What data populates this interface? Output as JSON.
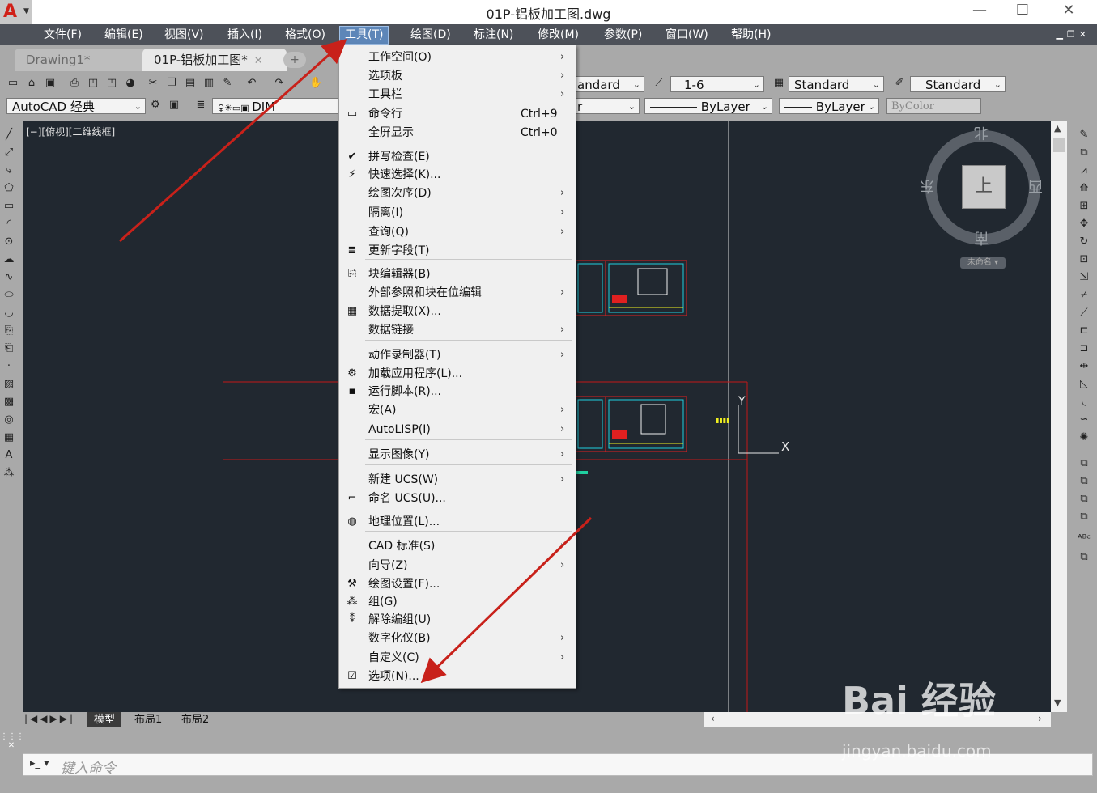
{
  "window": {
    "title": "01P-铝板加工图.dwg",
    "minimize": "—",
    "maximize": "☐",
    "close": "✕"
  },
  "menubar": {
    "items": [
      {
        "label": "文件(F)"
      },
      {
        "label": "编辑(E)"
      },
      {
        "label": "视图(V)"
      },
      {
        "label": "插入(I)"
      },
      {
        "label": "格式(O)"
      },
      {
        "label": "工具(T)"
      },
      {
        "label": "绘图(D)"
      },
      {
        "label": "标注(N)"
      },
      {
        "label": "修改(M)"
      },
      {
        "label": "参数(P)"
      },
      {
        "label": "窗口(W)"
      },
      {
        "label": "帮助(H)"
      }
    ],
    "active": "工具(T)"
  },
  "tabs": [
    {
      "label": "Drawing1*"
    },
    {
      "label": "01P-铝板加工图*"
    }
  ],
  "toolbars": {
    "workspace": "AutoCAD 经典",
    "layer": "DIM",
    "dim_style": "andard",
    "scale": "1-6",
    "table_style": "Standard",
    "multileader_style": "Standard",
    "color_partial": "r",
    "linetype": "ByLayer",
    "lineweight": "ByLayer",
    "plotstyle": "ByColor"
  },
  "viewport_label": "[−][俯视][二维线框]",
  "viewcube": {
    "north": "北",
    "south": "南",
    "east": "东",
    "west": "西",
    "top": "上",
    "ucs": "未命名"
  },
  "ucs_icon": {
    "y": "Y",
    "x": "X"
  },
  "dropdown": {
    "items": [
      {
        "label": "工作空间(O)",
        "shortcut": "",
        "submenu": true,
        "icon": ""
      },
      {
        "label": "选项板",
        "shortcut": "",
        "submenu": true,
        "icon": ""
      },
      {
        "label": "工具栏",
        "shortcut": "",
        "submenu": true,
        "icon": ""
      },
      {
        "label": "命令行",
        "shortcut": "Ctrl+9",
        "submenu": false,
        "icon": "command-line-icon"
      },
      {
        "label": "全屏显示",
        "shortcut": "Ctrl+0",
        "submenu": false,
        "icon": ""
      },
      {
        "label": "拼写检查(E)",
        "shortcut": "",
        "submenu": false,
        "icon": "spellcheck-icon"
      },
      {
        "label": "快速选择(K)...",
        "shortcut": "",
        "submenu": false,
        "icon": "quick-select-icon"
      },
      {
        "label": "绘图次序(D)",
        "shortcut": "",
        "submenu": true,
        "icon": ""
      },
      {
        "label": "隔离(I)",
        "shortcut": "",
        "submenu": true,
        "icon": ""
      },
      {
        "label": "查询(Q)",
        "shortcut": "",
        "submenu": true,
        "icon": ""
      },
      {
        "label": "更新字段(T)",
        "shortcut": "",
        "submenu": false,
        "icon": "update-field-icon"
      },
      {
        "label": "块编辑器(B)",
        "shortcut": "",
        "submenu": false,
        "icon": "block-editor-icon"
      },
      {
        "label": "外部参照和块在位编辑",
        "shortcut": "",
        "submenu": true,
        "icon": ""
      },
      {
        "label": "数据提取(X)...",
        "shortcut": "",
        "submenu": false,
        "icon": "data-extraction-icon"
      },
      {
        "label": "数据链接",
        "shortcut": "",
        "submenu": true,
        "icon": ""
      },
      {
        "label": "动作录制器(T)",
        "shortcut": "",
        "submenu": true,
        "icon": ""
      },
      {
        "label": "加载应用程序(L)...",
        "shortcut": "",
        "submenu": false,
        "icon": "load-app-icon"
      },
      {
        "label": "运行脚本(R)...",
        "shortcut": "",
        "submenu": false,
        "icon": "run-script-icon"
      },
      {
        "label": "宏(A)",
        "shortcut": "",
        "submenu": true,
        "icon": ""
      },
      {
        "label": "AutoLISP(I)",
        "shortcut": "",
        "submenu": true,
        "icon": ""
      },
      {
        "label": "显示图像(Y)",
        "shortcut": "",
        "submenu": true,
        "icon": ""
      },
      {
        "label": "新建 UCS(W)",
        "shortcut": "",
        "submenu": true,
        "icon": ""
      },
      {
        "label": "命名 UCS(U)...",
        "shortcut": "",
        "submenu": false,
        "icon": "named-ucs-icon"
      },
      {
        "label": "地理位置(L)...",
        "shortcut": "",
        "submenu": false,
        "icon": "geolocation-icon"
      },
      {
        "label": "CAD 标准(S)",
        "shortcut": "",
        "submenu": true,
        "icon": ""
      },
      {
        "label": "向导(Z)",
        "shortcut": "",
        "submenu": true,
        "icon": ""
      },
      {
        "label": "绘图设置(F)...",
        "shortcut": "",
        "submenu": false,
        "icon": "drafting-settings-icon"
      },
      {
        "label": "组(G)",
        "shortcut": "",
        "submenu": false,
        "icon": "group-icon"
      },
      {
        "label": "解除编组(U)",
        "shortcut": "",
        "submenu": false,
        "icon": "ungroup-icon"
      },
      {
        "label": "数字化仪(B)",
        "shortcut": "",
        "submenu": true,
        "icon": ""
      },
      {
        "label": "自定义(C)",
        "shortcut": "",
        "submenu": true,
        "icon": ""
      },
      {
        "label": "选项(N)...",
        "shortcut": "",
        "submenu": false,
        "icon": "options-check-icon"
      }
    ]
  },
  "layout_tabs": [
    {
      "label": "模型"
    },
    {
      "label": "布局1"
    },
    {
      "label": "布局2"
    }
  ],
  "command": {
    "placeholder": "键入命令"
  },
  "watermark": {
    "brand": "Bai 经验",
    "url": "jingyan.baidu.com"
  },
  "colors": {
    "menubar": "#4d5159",
    "canvas": "#212830",
    "active_menu": "#5d86b8",
    "annotation_arrow": "#c8211a"
  }
}
